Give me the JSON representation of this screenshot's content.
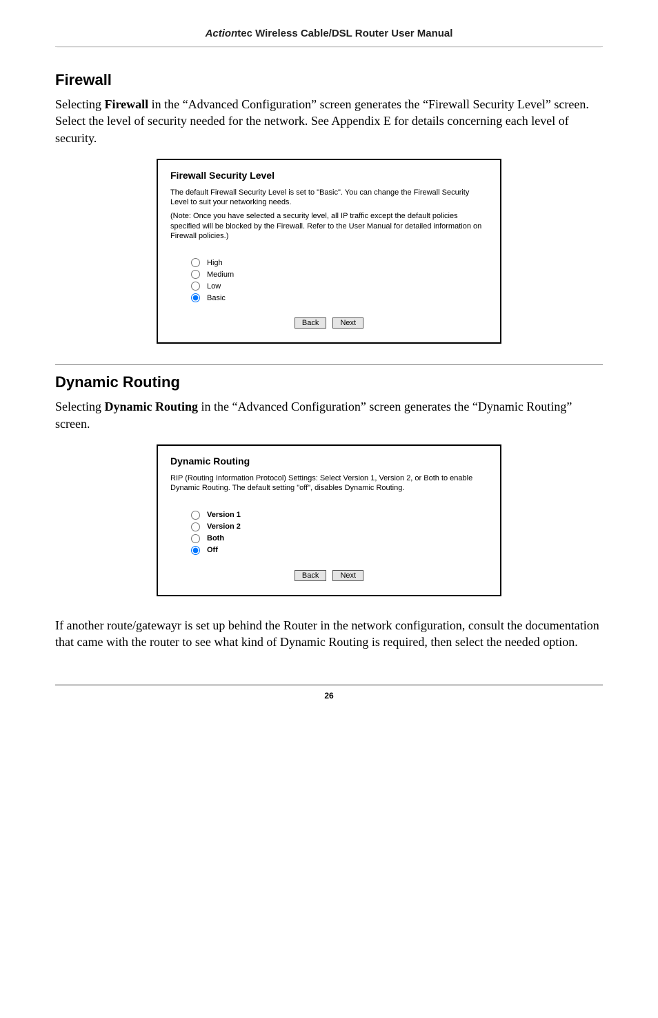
{
  "header": {
    "brand": "Action",
    "brand_suffix": "tec",
    "title_rest": " Wireless Cable/DSL Router User Manual"
  },
  "firewall": {
    "heading": "Firewall",
    "intro_pre": "Selecting ",
    "intro_bold": "Firewall",
    "intro_mid": " in the “Advanced Configuration” screen generates the “",
    "intro_term": "Firewall Security Level",
    "intro_post": "” screen. Select the level of security needed for the network. See Appendix E for details concerning each level of security.",
    "screenshot": {
      "title": "Firewall Security Level",
      "para1": "The default Firewall Security Level is set to \"Basic\". You can change the Firewall Security Level to suit your networking needs.",
      "para2": "(Note: Once you have selected a security level, all IP traffic except the default policies specified will be blocked by the Firewall. Refer to the User Manual for detailed information on Firewall policies.)",
      "options": [
        "High",
        "Medium",
        "Low",
        "Basic"
      ],
      "selected_index": 3,
      "back": "Back",
      "next": "Next"
    }
  },
  "dynamic": {
    "heading": "Dynamic Routing",
    "intro_pre": "Selecting ",
    "intro_bold": "Dynamic Routing",
    "intro_post": " in the “Advanced Configuration” screen generates the “Dynamic Routing” screen.",
    "screenshot": {
      "title": "Dynamic Routing",
      "para1": "RIP (Routing Information Protocol) Settings: Select Version 1, Version 2, or Both to enable Dynamic Routing. The default setting \"off\", disables Dynamic Routing.",
      "options": [
        "Version 1",
        "Version 2",
        "Both",
        "Off"
      ],
      "selected_index": 3,
      "back": "Back",
      "next": "Next"
    },
    "closing": "If another route/gatewayr is set up behind the Router in the network configuration, consult the documentation that came with the router to see what kind of Dynamic Routing is required, then select the needed option."
  },
  "page_number": "26"
}
